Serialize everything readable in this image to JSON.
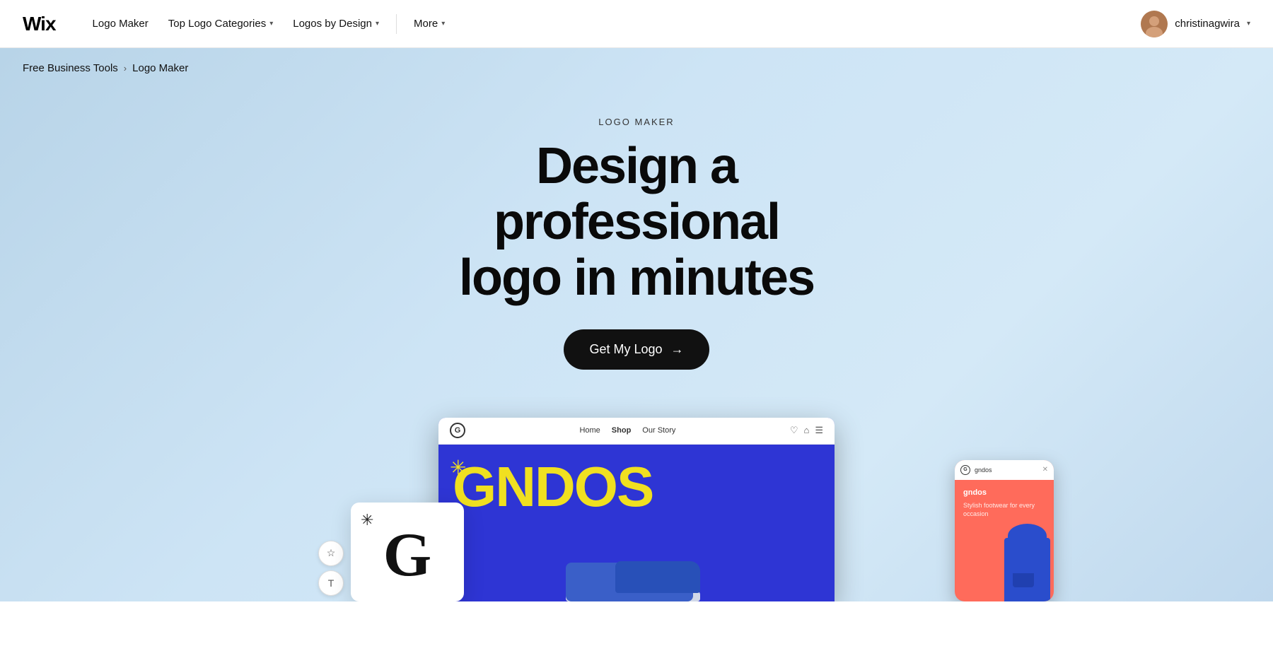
{
  "navbar": {
    "logo": "Wix",
    "links": [
      {
        "label": "Logo Maker",
        "hasDropdown": false
      },
      {
        "label": "Top Logo Categories",
        "hasDropdown": true
      },
      {
        "label": "Logos by Design",
        "hasDropdown": true
      },
      {
        "label": "More",
        "hasDropdown": true
      }
    ],
    "user": {
      "name": "christinagwira",
      "hasDropdown": true
    }
  },
  "breadcrumb": {
    "items": [
      {
        "label": "Free Business Tools",
        "link": true
      },
      {
        "separator": ">"
      },
      {
        "label": "Logo Maker",
        "link": false
      }
    ]
  },
  "hero": {
    "eyebrow": "LOGO MAKER",
    "title_line1": "Design a professional",
    "title_line2": "logo in minutes",
    "cta_label": "Get My Logo",
    "cta_arrow": "→"
  },
  "preview": {
    "logo_letter": "G",
    "logo_snowflake": "✳",
    "browser": {
      "logo_label": "G",
      "nav_items": [
        "Home",
        "Shop",
        "Our Story"
      ],
      "active_nav": "Shop",
      "headline": "GNDOS",
      "sun": "✳"
    },
    "phone": {
      "logo_label": "G",
      "title": "gndos",
      "subtitle": "Stylish footwear for every occasion"
    }
  },
  "toolbar": {
    "star_icon": "☆",
    "text_icon": "T"
  }
}
